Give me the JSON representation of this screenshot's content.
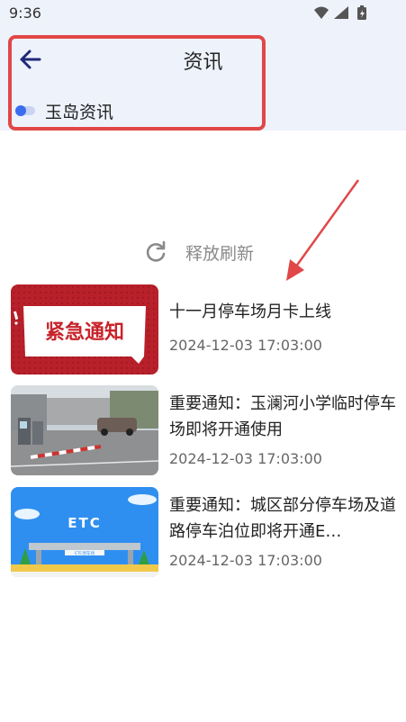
{
  "status_bar": {
    "time": "9:36"
  },
  "header": {
    "title": "资讯",
    "subtitle": "玉岛资讯"
  },
  "refresh": {
    "label": "释放刷新"
  },
  "thumbnail_texts": {
    "urgent": "紧急通知",
    "etc": "ETC",
    "etc_sign": "ETC停车场"
  },
  "news": [
    {
      "title": "十一月停车场月卡上线",
      "date": "2024-12-03 17:03:00"
    },
    {
      "title": "重要通知：玉澜河小学临时停车场即将开通使用",
      "date": "2024-12-03 17:03:00"
    },
    {
      "title": "重要通知：城区部分停车场及道路停车泊位即将开通E…",
      "date": "2024-12-03 17:03:00"
    }
  ],
  "colors": {
    "header_bg": "#eef2fb",
    "annotation_red": "#e04848",
    "toggle_blue": "#3b6df0"
  }
}
